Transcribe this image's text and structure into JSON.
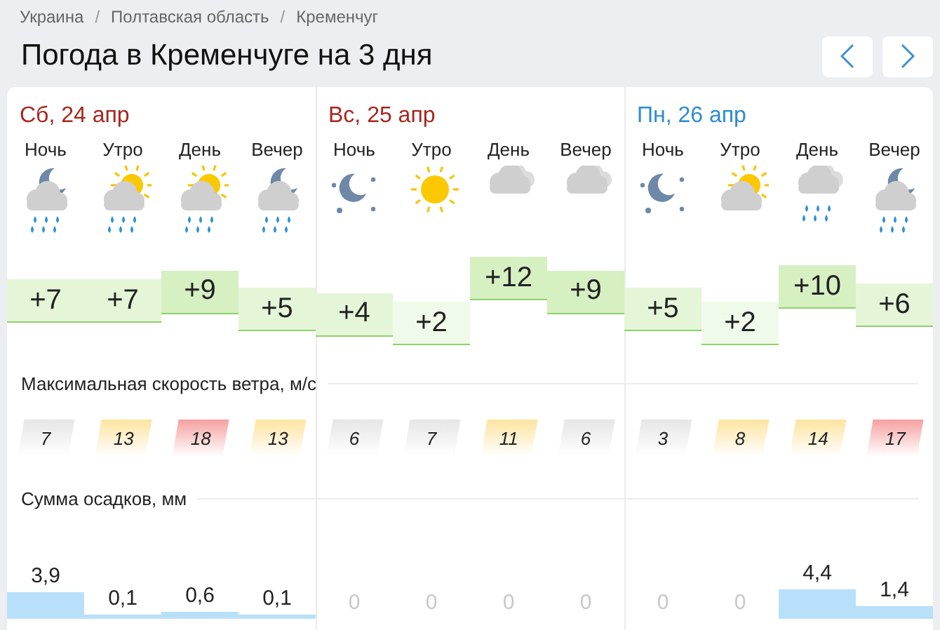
{
  "breadcrumbs": [
    {
      "label": "Украина"
    },
    {
      "label": "Полтавская область",
      "separator": "/"
    },
    {
      "label": "Кременчуг",
      "separator": "/"
    }
  ],
  "title": "Погода в Кременчуге на 3 дня",
  "nav": [
    {
      "kind": "prev"
    },
    {
      "kind": "next"
    }
  ],
  "days": [
    {
      "label": "Сб, 24 апр",
      "weekend": true,
      "periods": [
        {
          "name": "Ночь",
          "weather": {
            "kind": "moon-cloud-rain"
          },
          "temp": "+7",
          "wind": {
            "value": "7",
            "color": "#e6e6e6"
          },
          "precip": "3,9"
        },
        {
          "name": "Утро",
          "weather": {
            "kind": "sun-cloud-rain"
          },
          "temp": "+7",
          "wind": {
            "value": "13",
            "color": "#fde4a0"
          },
          "precip": "0,1"
        },
        {
          "name": "День",
          "weather": {
            "kind": "sun-cloud-rain"
          },
          "temp": "+9",
          "wind": {
            "value": "18",
            "color": "#f6a0a0"
          },
          "precip": "0,6"
        },
        {
          "name": "Вечер",
          "weather": {
            "kind": "moon-cloud-rain"
          },
          "temp": "+5",
          "wind": {
            "value": "13",
            "color": "#fde4a0"
          },
          "precip": "0,1"
        }
      ]
    },
    {
      "label": "Вс, 25 апр",
      "weekend": true,
      "periods": [
        {
          "name": "Ночь",
          "weather": {
            "kind": "moon-stars"
          },
          "temp": "+4",
          "wind": {
            "value": "6",
            "color": "#e6e6e6"
          },
          "precip": "0"
        },
        {
          "name": "Утро",
          "weather": {
            "kind": "sun"
          },
          "temp": "+2",
          "wind": {
            "value": "7",
            "color": "#e6e6e6"
          },
          "precip": "0"
        },
        {
          "name": "День",
          "weather": {
            "kind": "clouds"
          },
          "temp": "+12",
          "wind": {
            "value": "11",
            "color": "#fde4a0"
          },
          "precip": "0"
        },
        {
          "name": "Вечер",
          "weather": {
            "kind": "clouds"
          },
          "temp": "+9",
          "wind": {
            "value": "6",
            "color": "#e6e6e6"
          },
          "precip": "0"
        }
      ]
    },
    {
      "label": "Пн, 26 апр",
      "weekend": false,
      "periods": [
        {
          "name": "Ночь",
          "weather": {
            "kind": "moon-stars"
          },
          "temp": "+5",
          "wind": {
            "value": "3",
            "color": "#e6e6e6"
          },
          "precip": "0"
        },
        {
          "name": "Утро",
          "weather": {
            "kind": "sun-cloud"
          },
          "temp": "+2",
          "wind": {
            "value": "8",
            "color": "#fde4a0"
          },
          "precip": "0"
        },
        {
          "name": "День",
          "weather": {
            "kind": "clouds-rain"
          },
          "temp": "+10",
          "wind": {
            "value": "14",
            "color": "#fde4a0"
          },
          "precip": "4,4"
        },
        {
          "name": "Вечер",
          "weather": {
            "kind": "moon-cloud-rain"
          },
          "temp": "+6",
          "wind": {
            "value": "17",
            "color": "#f6a0a0"
          },
          "precip": "1,4"
        }
      ]
    }
  ],
  "wind_label": "Максимальная скорость ветра, м/с",
  "precip_label": "Сумма осадков, мм"
}
